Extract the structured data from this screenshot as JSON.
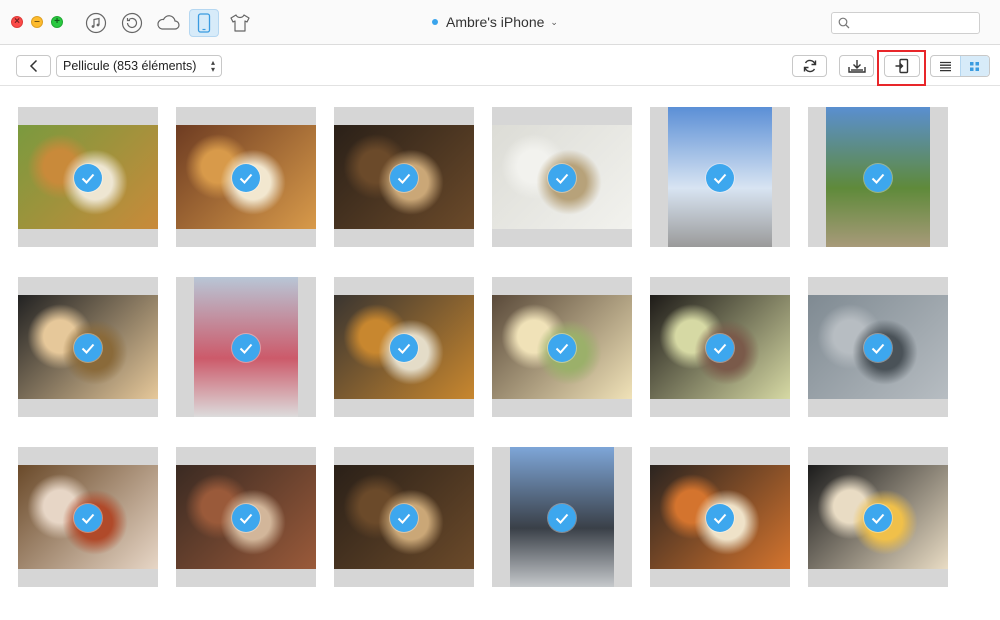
{
  "window": {
    "title": "Ambre's iPhone"
  },
  "titlebar": {
    "buttons": [
      "close",
      "minimize",
      "zoom"
    ],
    "nav_icons": [
      "music-icon",
      "history-icon",
      "cloud-icon",
      "iphone-icon",
      "tshirt-icon"
    ],
    "active_icon": "iphone-icon",
    "device_name": "Ambre's iPhone",
    "device_status_color": "#3aa4ec"
  },
  "search": {
    "placeholder": "",
    "value": ""
  },
  "toolbar": {
    "back_icon": "chevron-left-icon",
    "album_label": "Pellicule (853 éléments)",
    "actions": [
      "refresh-icon",
      "export-to-computer-icon",
      "import-to-device-icon"
    ],
    "highlighted_action": "import-to-device-icon",
    "highlight_color": "#e8262a",
    "view_modes": [
      "list-view-icon",
      "grid-view-icon"
    ],
    "active_view": "grid-view-icon"
  },
  "accent_color": "#3da7ee",
  "photos": [
    {
      "subject": "curry rice tray",
      "orientation": "landscape",
      "selected": true
    },
    {
      "subject": "pizza and ramen",
      "orientation": "landscape",
      "selected": true
    },
    {
      "subject": "japanese set meal",
      "orientation": "landscape",
      "selected": true
    },
    {
      "subject": "white plate dessert",
      "orientation": "landscape",
      "selected": true
    },
    {
      "subject": "city street sky",
      "orientation": "portrait",
      "selected": true
    },
    {
      "subject": "statue in garden",
      "orientation": "portrait",
      "selected": true
    },
    {
      "subject": "ramen bowl",
      "orientation": "landscape",
      "selected": true
    },
    {
      "subject": "building and cars",
      "orientation": "portrait",
      "selected": true
    },
    {
      "subject": "tonkatsu plate",
      "orientation": "landscape",
      "selected": true
    },
    {
      "subject": "set meal tray",
      "orientation": "landscape",
      "selected": true
    },
    {
      "subject": "green tea bowl",
      "orientation": "landscape",
      "selected": true
    },
    {
      "subject": "rainy town view",
      "orientation": "landscape",
      "selected": true
    },
    {
      "subject": "curry dinner table",
      "orientation": "landscape",
      "selected": true
    },
    {
      "subject": "sizzling steak plate",
      "orientation": "landscape",
      "selected": true
    },
    {
      "subject": "japanese set meal",
      "orientation": "landscape",
      "selected": true
    },
    {
      "subject": "skyscraper street",
      "orientation": "portrait",
      "selected": true
    },
    {
      "subject": "spicy ramen",
      "orientation": "landscape",
      "selected": true
    },
    {
      "subject": "tonkotsu ramen",
      "orientation": "landscape",
      "selected": true
    }
  ]
}
